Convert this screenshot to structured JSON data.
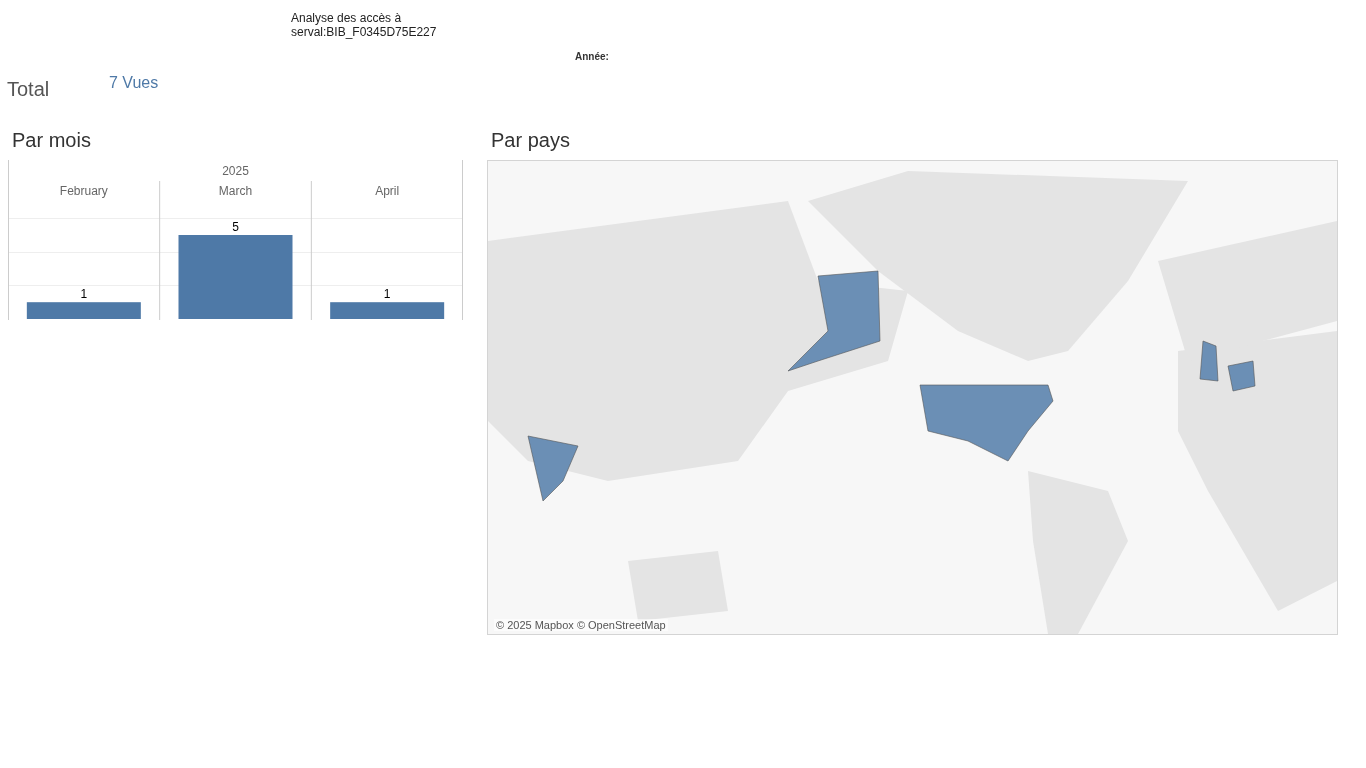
{
  "header": {
    "title_lines": [
      "Analyse des accès à",
      "serval:BIB_F0345D75E227"
    ],
    "year_filter_label": "Année:"
  },
  "total": {
    "label": "Total",
    "value": "7 Vues"
  },
  "by_month": {
    "title": "Par mois",
    "chart_data": {
      "type": "bar",
      "title": "2025",
      "categories": [
        "February",
        "March",
        "April"
      ],
      "values": [
        1,
        5,
        1
      ],
      "data_labels": true
    }
  },
  "by_country": {
    "title": "Par pays",
    "attribution": "© 2025 Mapbox © OpenStreetMap"
  }
}
